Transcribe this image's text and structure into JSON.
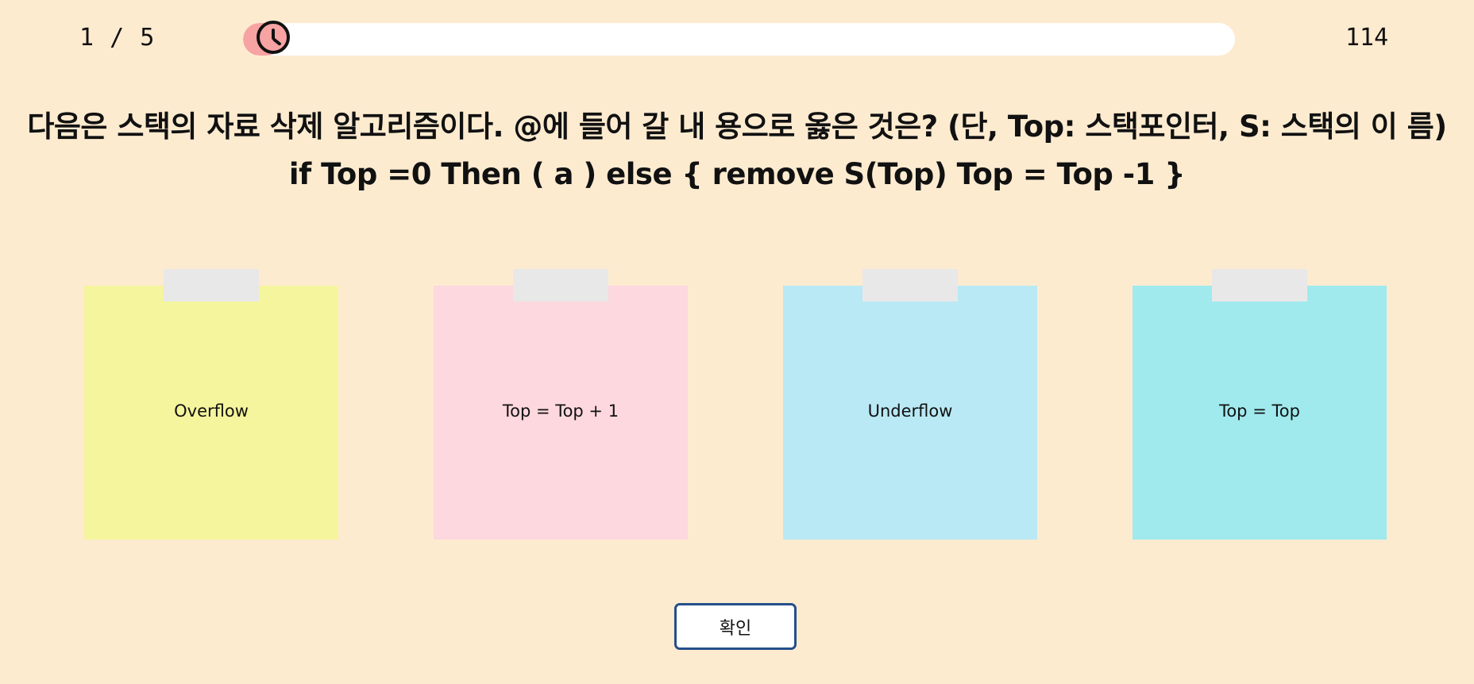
{
  "header": {
    "question_counter": "1 / 5",
    "time_remaining": "114",
    "timer_progress_percent": 4,
    "timer_fill_color": "#f7a3a3"
  },
  "question": {
    "text": "다음은 스택의 자료 삭제 알고리즘이다. @에 들어 갈 내 용으로 옳은 것은? (단, Top: 스택포인터, S: 스택의 이 름) if Top =0 Then ( a ) else { remove S(Top) Top = Top -1 }"
  },
  "options": [
    {
      "label": "Overflow",
      "color": "#f4f59c"
    },
    {
      "label": "Top = Top + 1",
      "color": "#fdd8de"
    },
    {
      "label": "Underflow",
      "color": "#b9e9f5"
    },
    {
      "label": "Top = Top",
      "color": "#a0eaee"
    }
  ],
  "actions": {
    "confirm_label": "확인"
  }
}
